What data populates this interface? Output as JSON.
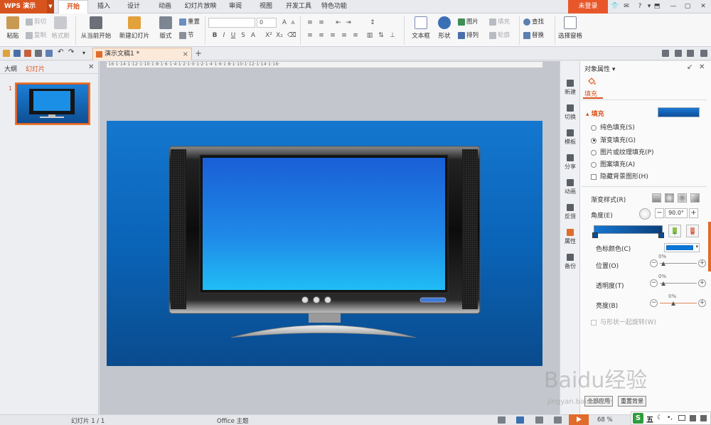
{
  "app": {
    "name": "WPS 演示",
    "login_label": "未登录"
  },
  "menu": {
    "tabs": [
      "开始",
      "插入",
      "设计",
      "动画",
      "幻灯片放映",
      "审阅",
      "视图",
      "开发工具",
      "特色功能"
    ],
    "active_tab": "开始"
  },
  "ribbon": {
    "paste": "粘贴",
    "cut": "剪切",
    "copy": "复制",
    "format_painter": "格式刷",
    "from_current": "从当前开始",
    "new_slide": "新建幻灯片",
    "layout": "版式",
    "reset": "重置",
    "section": "节",
    "font_name": "",
    "font_size": "0",
    "text_box": "文本框",
    "shape": "形状",
    "arrange": "排列",
    "picture": "图片",
    "fill": "填充",
    "outline": "轮廓",
    "find": "查找",
    "replace": "替换",
    "select_pane": "选择窗格"
  },
  "document": {
    "tab_title": "演示文稿1 *"
  },
  "left_panel": {
    "tab_outline": "大纲",
    "tab_slides": "幻灯片",
    "slide_number": "1"
  },
  "ruler": {
    "text": "·16·1·14·1·12·1·10·1·8·1·6·1·4·1·2·1·0·1·2·1·4·1·6·1·8·1·10·1·12·1·14·1·16·"
  },
  "sidebar": {
    "items": [
      "新建",
      "切换",
      "模板",
      "分享",
      "动画",
      "反馈",
      "属性",
      "备份"
    ],
    "active": "属性"
  },
  "pane": {
    "title": "对象属性",
    "fill_tab": "填充",
    "section_fill": "填充",
    "fill_color": "#0f63b8",
    "options": [
      {
        "label": "纯色填充(S)",
        "checked": false
      },
      {
        "label": "渐变填充(G)",
        "checked": true
      },
      {
        "label": "图片或纹理填充(P)",
        "checked": false
      },
      {
        "label": "图案填充(A)",
        "checked": false
      }
    ],
    "hide_bg": "隐藏背景图形(H)",
    "gradient_style": "渐变样式(R)",
    "angle_label": "角度(E)",
    "angle_value": "90.0°",
    "stop_color_label": "色标颜色(C)",
    "stop_color": "#0c74d2",
    "position_label": "位置(O)",
    "position_value": "0%",
    "transparency_label": "透明度(T)",
    "transparency_value": "0%",
    "brightness_label": "亮度(B)",
    "brightness_value": "0%",
    "rotate_with_shape": "与形状一起旋转(W)",
    "apply_all": "全部应用",
    "reset_bg": "重置背景"
  },
  "status": {
    "slide_info": "幻灯片 1 / 1",
    "theme": "Office 主题",
    "zoom": "68 %"
  },
  "ime": {
    "mode": "五"
  },
  "watermark": {
    "text": "Baidu经验",
    "sub": "jingyan.baidu.com"
  }
}
